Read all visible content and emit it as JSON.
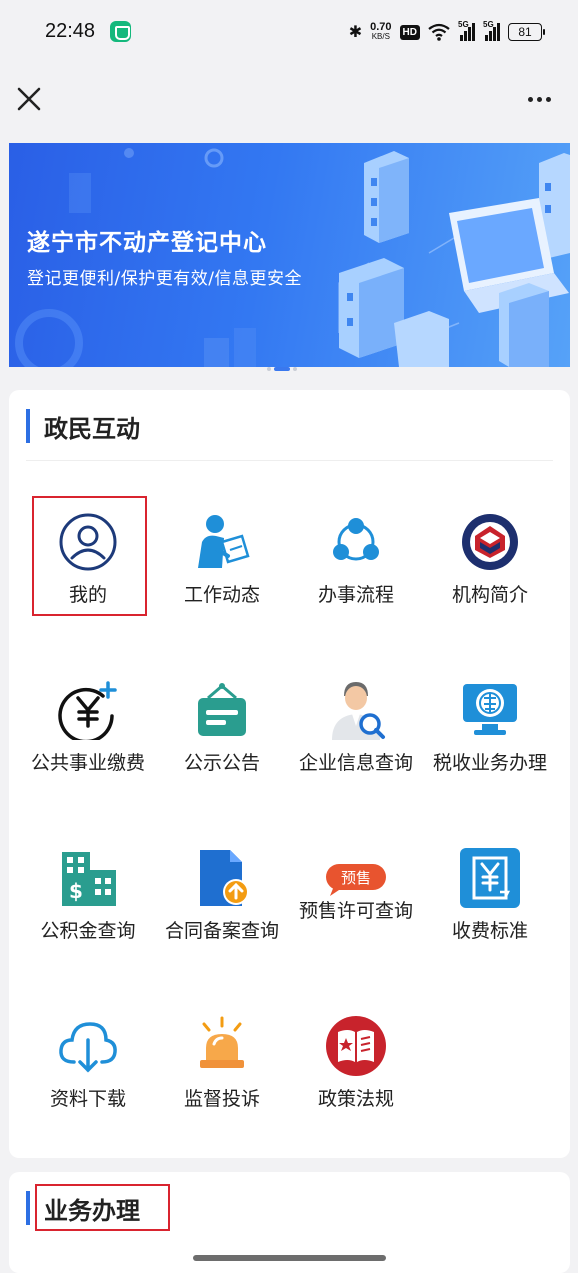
{
  "status_bar": {
    "time": "22:48",
    "speed_value": "0.70",
    "speed_unit": "KB/S",
    "hd_label": "HD",
    "sig1_label": "5G",
    "sig2_label": "5G",
    "battery": "81"
  },
  "banner": {
    "title": "遂宁市不动产登记中心",
    "subtitle": "登记更便利/保护更有效/信息更安全"
  },
  "section1": {
    "title": "政民互动",
    "items": [
      {
        "label": "我的",
        "icon": "user-icon"
      },
      {
        "label": "工作动态",
        "icon": "reading-person-icon"
      },
      {
        "label": "办事流程",
        "icon": "flow-icon"
      },
      {
        "label": "机构简介",
        "icon": "emblem-icon"
      },
      {
        "label": "公共事业缴费",
        "icon": "yuan-plus-icon"
      },
      {
        "label": "公示公告",
        "icon": "notice-board-icon"
      },
      {
        "label": "企业信息查询",
        "icon": "business-person-icon"
      },
      {
        "label": "税收业务办理",
        "icon": "tax-monitor-icon"
      },
      {
        "label": "公积金查询",
        "icon": "building-dollar-icon"
      },
      {
        "label": "合同备案查询",
        "icon": "document-upload-icon"
      },
      {
        "label": "预售许可查询",
        "icon": "presale-tag-icon",
        "tag": "预售"
      },
      {
        "label": "收费标准",
        "icon": "yuan-document-icon"
      },
      {
        "label": "资料下载",
        "icon": "cloud-download-icon"
      },
      {
        "label": "监督投诉",
        "icon": "alarm-light-icon"
      },
      {
        "label": "政策法规",
        "icon": "law-book-icon"
      }
    ]
  },
  "section2": {
    "title": "业务办理"
  },
  "colors": {
    "accent": "#2d6fe3",
    "highlight": "#d9242f",
    "teal": "#2a9d8f"
  }
}
